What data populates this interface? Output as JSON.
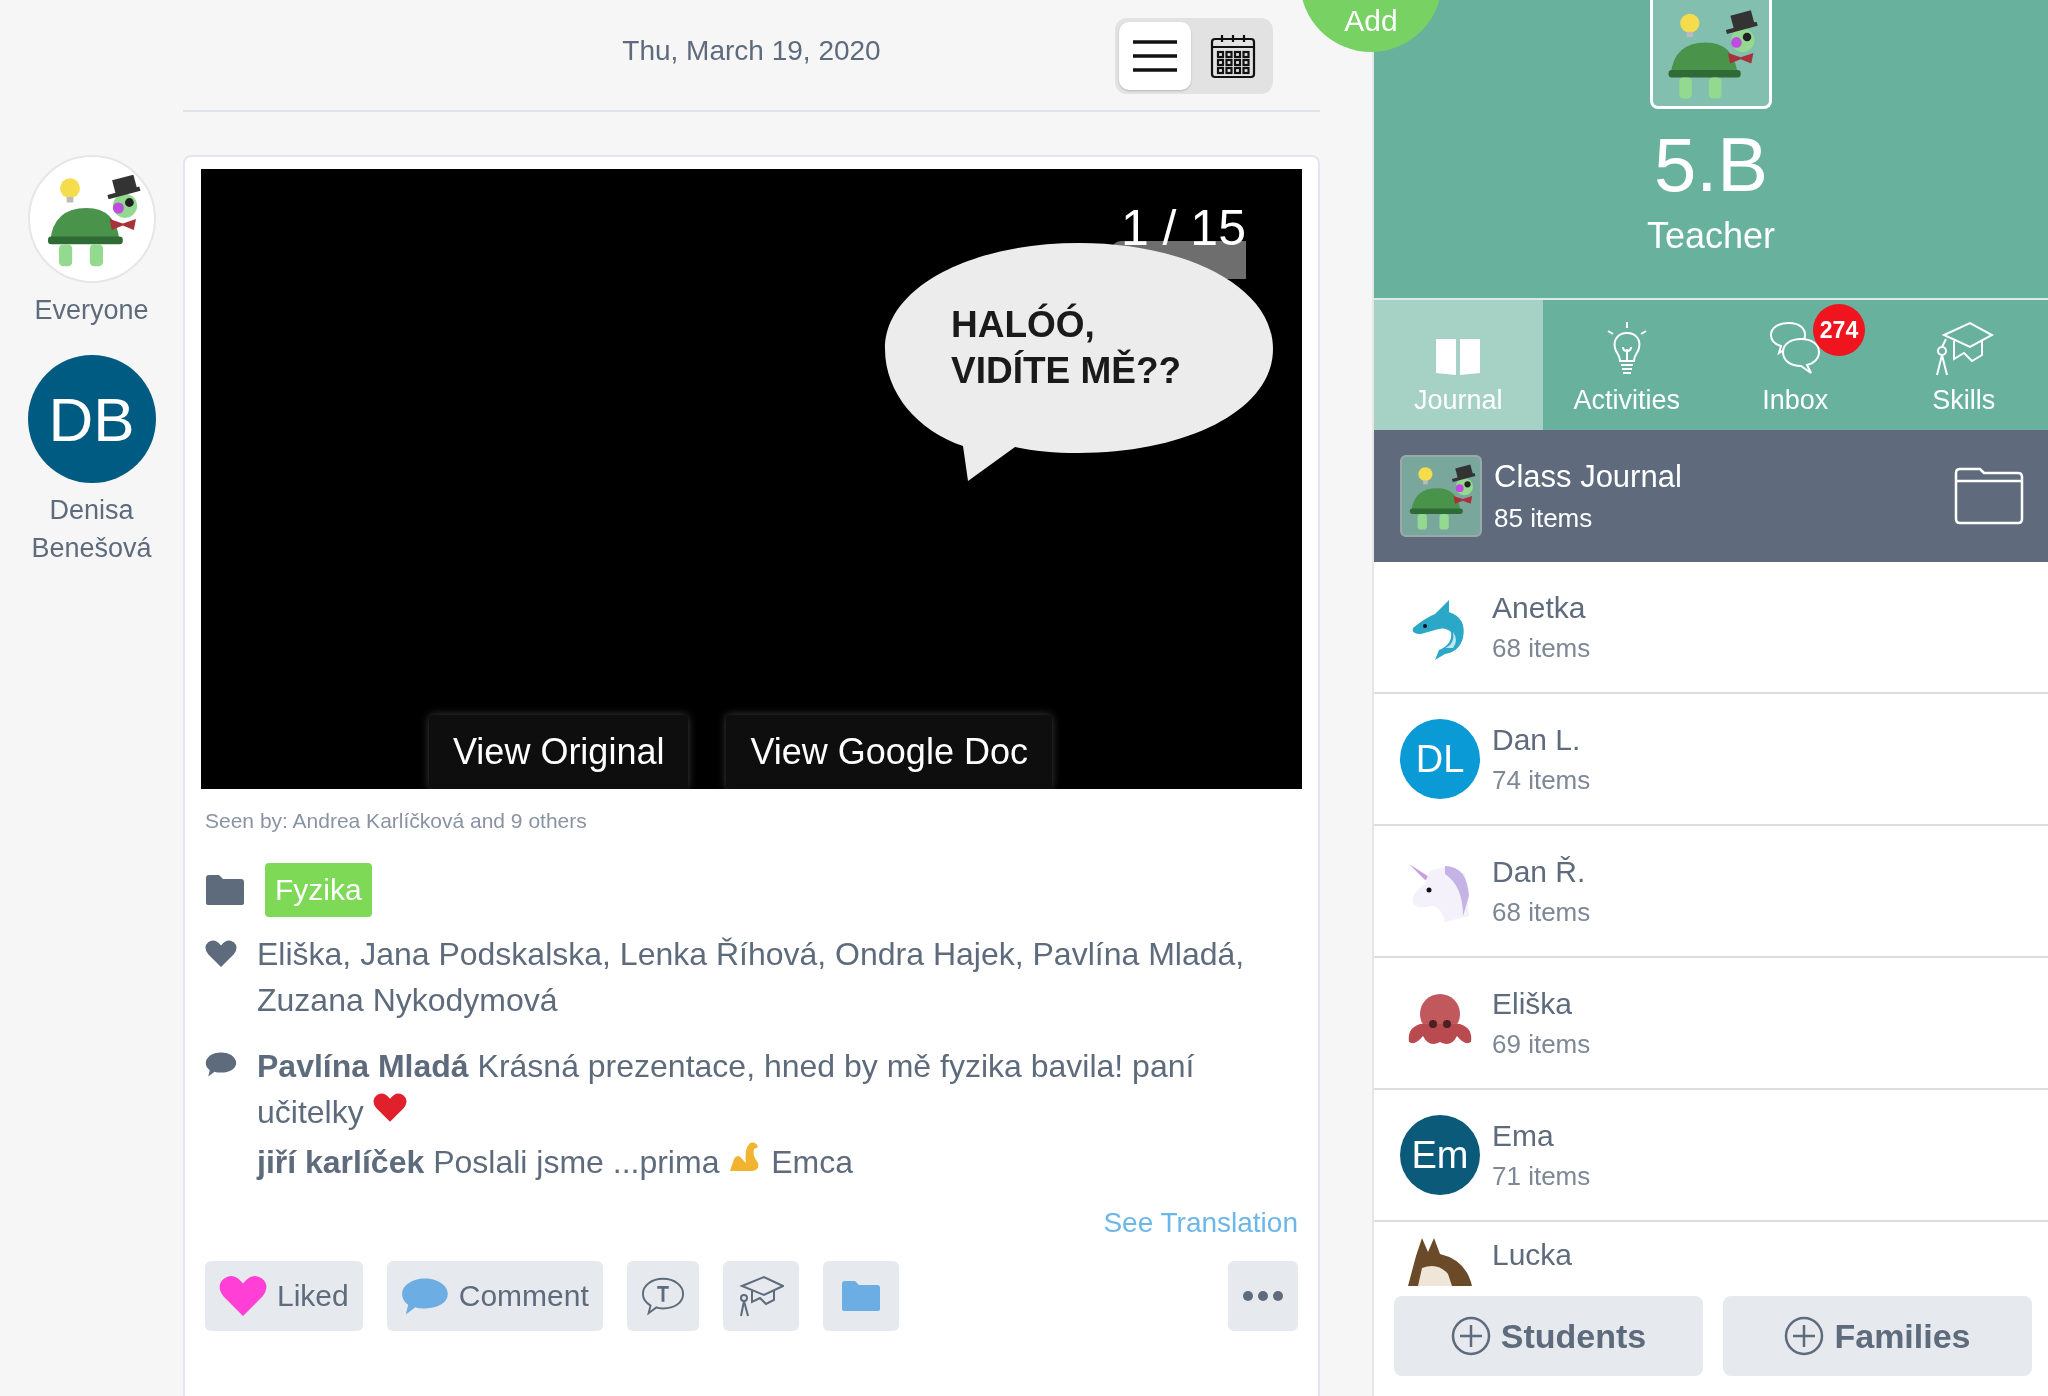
{
  "header": {
    "date": "Thu, March 19, 2020",
    "view_toggle": [
      {
        "kind": "list",
        "selected": true
      },
      {
        "kind": "calendar",
        "selected": false
      }
    ]
  },
  "audience": [
    {
      "kind": "class",
      "label": "Everyone"
    },
    {
      "kind": "initials",
      "initials": "DB",
      "label": "Denisa Benešová"
    }
  ],
  "post": {
    "slide": {
      "counter": "1 / 15",
      "bubble_lines": [
        "HALÓÓ,",
        "VIDÍTE MĚ??"
      ],
      "buttons": [
        "View Original",
        "View Google Doc"
      ]
    },
    "seen_by": "Seen by: Andrea Karlíčková and 9 others",
    "tag": "Fyzika",
    "likes": "Eliška, Jana Podskalska, Lenka Říhová, Ondra Hajek, Pavlína Mladá, Zuzana Nykodymová",
    "comments": [
      {
        "parts": [
          {
            "kind": "text",
            "text": "**Pavlína Mladá** Krásná prezentace, hned by mě fyzika bavila! paní"
          },
          {
            "kind": "text",
            "text": "učitelky"
          },
          {
            "kind": "heart"
          }
        ]
      },
      {
        "parts": [
          {
            "kind": "text",
            "text": "**jiří karlíček** Poslali jsme ...prima"
          },
          {
            "kind": "arm"
          },
          {
            "kind": "text",
            "text": "Emca"
          }
        ]
      }
    ],
    "see_translation": "See Translation",
    "actions": [
      {
        "kind": "like",
        "label": "Liked",
        "selected": true
      },
      {
        "kind": "comment",
        "label": "Comment"
      },
      {
        "kind": "text"
      },
      {
        "kind": "skills"
      },
      {
        "kind": "folder"
      },
      {
        "kind": "more"
      }
    ]
  },
  "add_button": {
    "label": "Add"
  },
  "class_panel": {
    "name": "5.B",
    "role": "Teacher",
    "tabs": [
      {
        "kind": "journal",
        "label": "Journal",
        "selected": true
      },
      {
        "kind": "activities",
        "label": "Activities",
        "selected": false
      },
      {
        "kind": "inbox",
        "label": "Inbox",
        "selected": false,
        "badge": "274"
      },
      {
        "kind": "skills",
        "label": "Skills",
        "selected": false
      }
    ],
    "class_journal": {
      "title": "Class Journal",
      "count": "85 items",
      "selected": true
    },
    "students": [
      {
        "kind": "dolphin",
        "name": "Anetka",
        "count": "68 items"
      },
      {
        "kind": "initials",
        "initials": "DL",
        "color": "#0a9ad6",
        "name": "Dan L.",
        "count": "74 items"
      },
      {
        "kind": "unicorn",
        "name": "Dan Ř.",
        "count": "68 items"
      },
      {
        "kind": "octopus",
        "name": "Eliška",
        "count": "69 items"
      },
      {
        "kind": "initials",
        "initials": "Em",
        "color": "#0b5a7a",
        "name": "Ema",
        "count": "71 items"
      },
      {
        "kind": "horse",
        "name": "Lucka"
      }
    ],
    "buttons": [
      "Students",
      "Families"
    ]
  }
}
